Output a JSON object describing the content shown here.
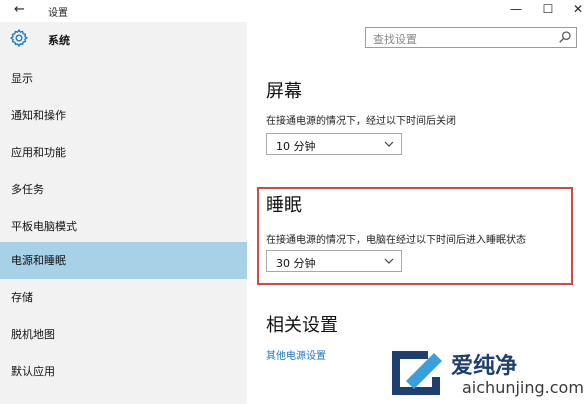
{
  "window": {
    "title": "设置",
    "back_icon": "←",
    "minimize_icon": "—",
    "maximize_icon": "☐",
    "close_icon": "✕"
  },
  "sidebar": {
    "header": "系统",
    "items": [
      {
        "label": "显示"
      },
      {
        "label": "通知和操作"
      },
      {
        "label": "应用和功能"
      },
      {
        "label": "多任务"
      },
      {
        "label": "平板电脑模式"
      },
      {
        "label": "电源和睡眠",
        "active": true
      },
      {
        "label": "存储"
      },
      {
        "label": "脱机地图"
      },
      {
        "label": "默认应用"
      }
    ]
  },
  "search": {
    "placeholder": "查找设置"
  },
  "screen": {
    "heading": "屏幕",
    "description": "在接通电源的情况下，经过以下时间后关闭",
    "value": "10 分钟"
  },
  "sleep": {
    "heading": "睡眠",
    "description": "在接通电源的情况下，电脑在经过以下时间后进入睡眠状态",
    "value": "30 分钟"
  },
  "related": {
    "heading": "相关设置",
    "link": "其他电源设置"
  },
  "watermark": {
    "name": "爱纯净",
    "url": "aichunjing.com"
  },
  "colors": {
    "active_item": "#a6d1e6",
    "highlight_border": "#d04a4a",
    "link": "#1a76c4"
  }
}
